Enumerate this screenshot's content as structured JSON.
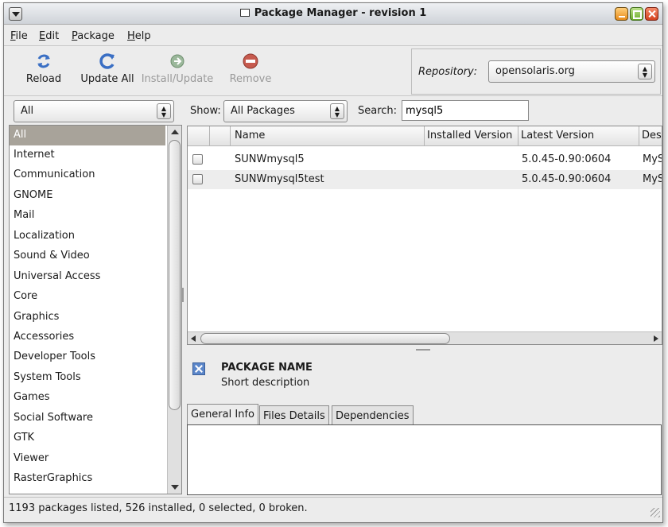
{
  "window": {
    "title": "Package Manager - revision 1"
  },
  "menubar": {
    "items": [
      {
        "label": "File",
        "mnemonic": "F",
        "rest": "ile"
      },
      {
        "label": "Edit",
        "mnemonic": "E",
        "rest": "dit"
      },
      {
        "label": "Package",
        "mnemonic": "P",
        "rest": "ackage"
      },
      {
        "label": "Help",
        "mnemonic": "H",
        "rest": "elp"
      }
    ]
  },
  "toolbar": {
    "reload_label": "Reload",
    "update_all_label": "Update All",
    "install_update_label": "Install/Update",
    "remove_label": "Remove",
    "repository_label": "Repository:",
    "repository_value": "opensolaris.org"
  },
  "filters": {
    "category_value": "All",
    "show_label": "Show:",
    "show_value": "All Packages",
    "search_label": "Search:",
    "search_value": "mysql5"
  },
  "categories": [
    "All",
    "Internet",
    "Communication",
    "GNOME",
    "Mail",
    "Localization",
    "Sound & Video",
    "Universal Access",
    "Core",
    "Graphics",
    "Accessories",
    "Developer Tools",
    "System Tools",
    "Games",
    "Social Software",
    "GTK",
    "Viewer",
    "RasterGraphics"
  ],
  "packages": {
    "columns": [
      "Name",
      "Installed Version",
      "Latest Version",
      "Des"
    ],
    "rows": [
      {
        "name": "SUNWmysql5",
        "installed": "",
        "latest": "5.0.45-0.90:0604",
        "desc": "MyS"
      },
      {
        "name": "SUNWmysql5test",
        "installed": "",
        "latest": "5.0.45-0.90:0604",
        "desc": "MyS"
      }
    ]
  },
  "details": {
    "name": "PACKAGE NAME",
    "description": "Short description",
    "tabs": [
      "General Info",
      "Files Details",
      "Dependencies"
    ]
  },
  "status": {
    "text": "1193 packages listed, 526 installed, 0 selected, 0 broken."
  },
  "colors": {
    "selected_category_bg": "#a8a39a",
    "titlebar": "#cfd3d9"
  }
}
